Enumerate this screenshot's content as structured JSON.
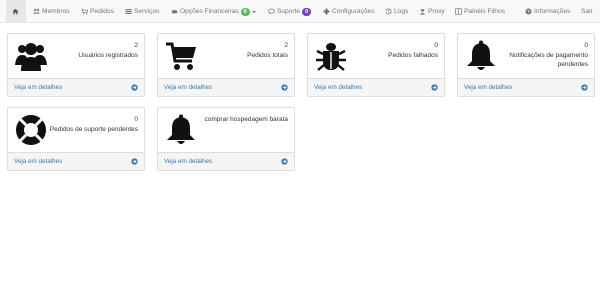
{
  "nav": {
    "items": [
      {
        "label": ""
      },
      {
        "label": "Membros"
      },
      {
        "label": "Pedidos"
      },
      {
        "label": "Serviços"
      },
      {
        "label": "Opções Financeiras",
        "badge": "0"
      },
      {
        "label": "Suporte",
        "badge": "0"
      },
      {
        "label": "Configurações"
      },
      {
        "label": "Logs"
      },
      {
        "label": "Proxy"
      },
      {
        "label": "Painéis Filhos"
      },
      {
        "label": "Informações"
      },
      {
        "label": "Sair"
      }
    ]
  },
  "panels": [
    {
      "count": "2",
      "label": "Usuários registrados",
      "link": "Veja em detalhes",
      "icon": "users-icon"
    },
    {
      "count": "2",
      "label": "Pedidos totais",
      "link": "Veja em detalhes",
      "icon": "shopping-cart-icon"
    },
    {
      "count": "0",
      "label": "Pedidos falhados",
      "link": "Veja em detalhes",
      "icon": "bug-icon"
    },
    {
      "count": "0",
      "label": "Notificações de pagamento pendentes",
      "link": "Veja em detalhes",
      "icon": "bell-icon"
    },
    {
      "count": "0",
      "label": "Pedidos de suporte pendentes",
      "link": "Veja em detalhes",
      "icon": "life-ring-icon"
    },
    {
      "count": "",
      "label": "comprar hospedagem barata",
      "link": "Veja em detalhes",
      "icon": "bell-icon"
    }
  ],
  "colors": {
    "link": "#337ab7",
    "badge_green": "#5cb85c",
    "badge_purple": "#6f42c1",
    "navbar_bg": "#f8f8f8"
  }
}
